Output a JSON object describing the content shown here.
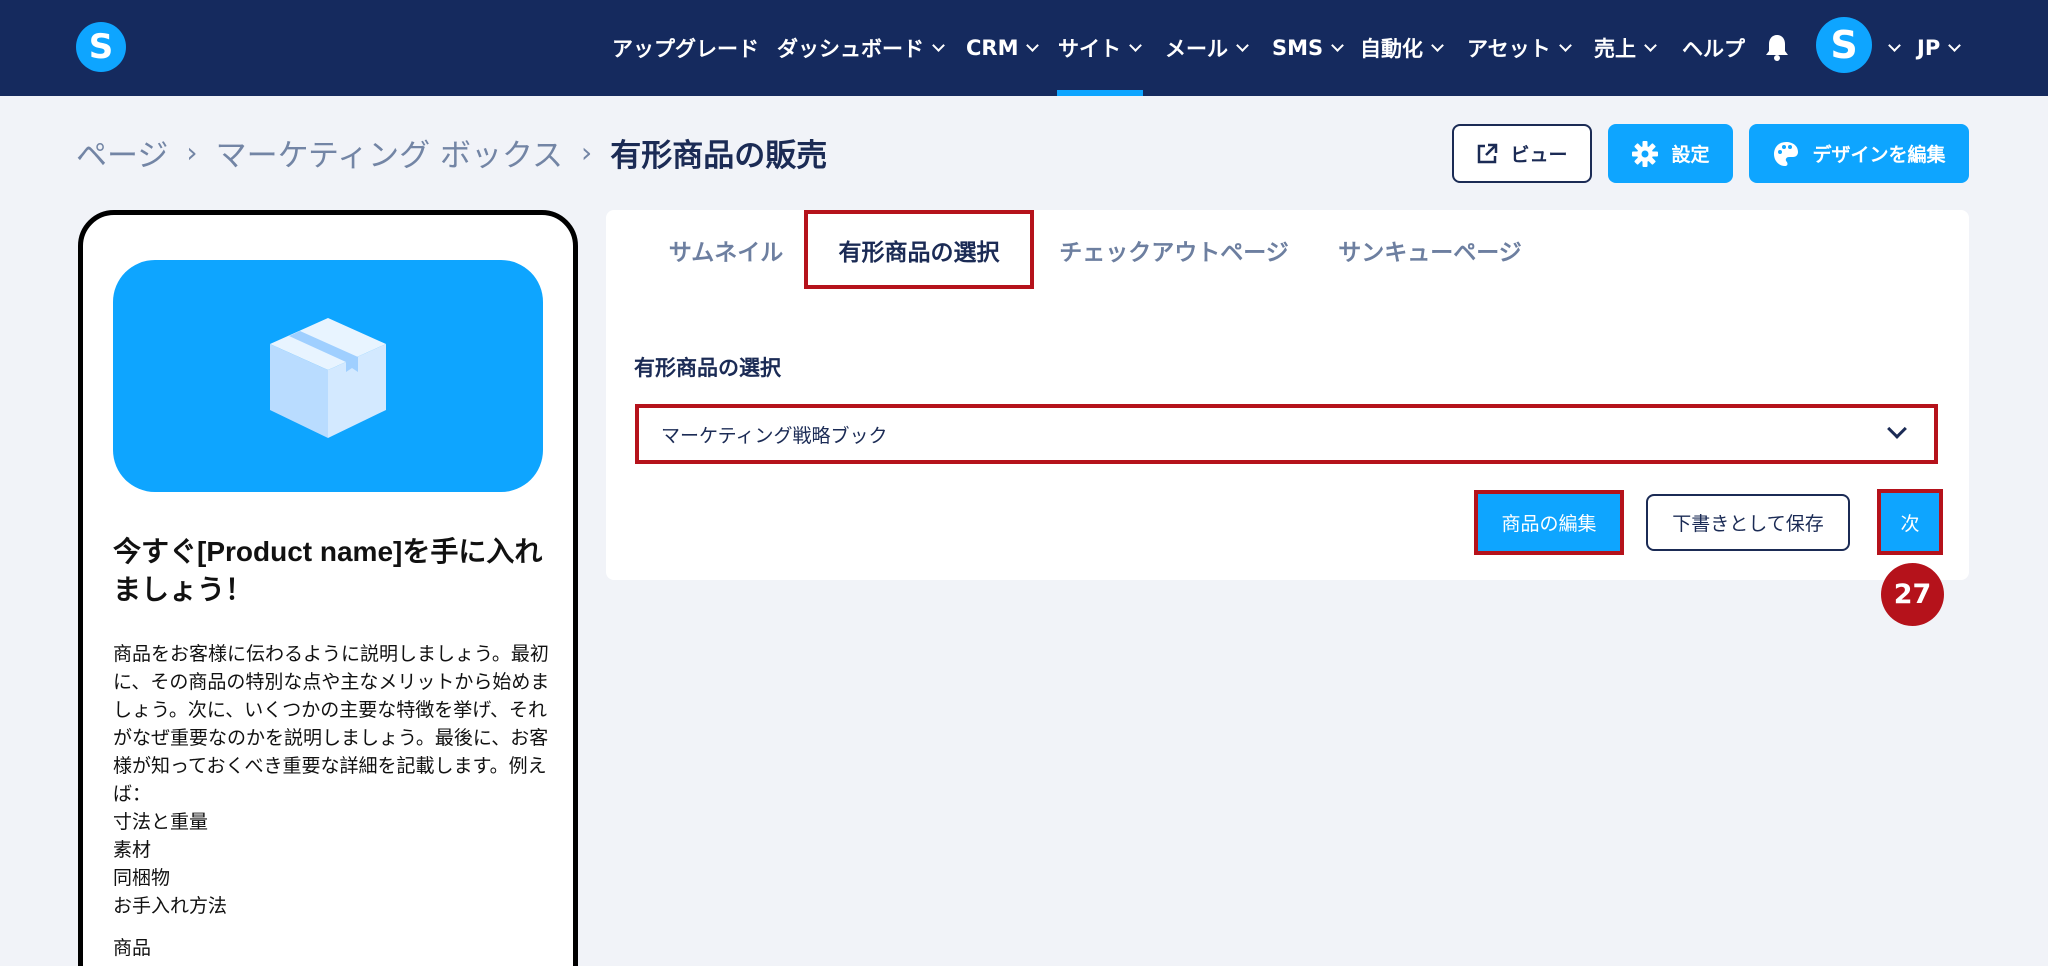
{
  "brand": {
    "logo_letter": "S"
  },
  "nav": {
    "items": [
      {
        "label": "アップグレード",
        "dropdown": false
      },
      {
        "label": "ダッシュボード",
        "dropdown": true
      },
      {
        "label": "CRM",
        "dropdown": true
      },
      {
        "label": "サイト",
        "dropdown": true,
        "active": true
      },
      {
        "label": "メール",
        "dropdown": true
      },
      {
        "label": "SMS",
        "dropdown": true
      },
      {
        "label": "自動化",
        "dropdown": true
      },
      {
        "label": "アセット",
        "dropdown": true
      },
      {
        "label": "売上",
        "dropdown": true
      },
      {
        "label": "ヘルプ",
        "dropdown": false
      }
    ],
    "avatar_letter": "S",
    "language": "JP"
  },
  "breadcrumb": {
    "items": [
      "ページ",
      "マーケティング ボックス"
    ],
    "current": "有形商品の販売"
  },
  "header_buttons": {
    "view": "ビュー",
    "settings": "設定",
    "design": "デザインを編集"
  },
  "preview": {
    "title": "今すぐ[Product name]を手に入れましょう！",
    "paragraph": "商品をお客様に伝わるように説明しましょう。最初に、その商品の特別な点や主なメリットから始めましょう。次に、いくつかの主要な特徴を挙げ、それがなぜ重要なのかを説明しましょう。最後に、お客様が知っておくべき重要な詳細を記載します。例えば：",
    "details": [
      "寸法と重量",
      "素材",
      "同梱物",
      "お手入れ方法"
    ],
    "footer": "商品"
  },
  "tabs": [
    {
      "label": "サムネイル"
    },
    {
      "label": "有形商品の選択",
      "active": true
    },
    {
      "label": "チェックアウトページ"
    },
    {
      "label": "サンキューページ"
    }
  ],
  "form": {
    "section_label": "有形商品の選択",
    "selected_product": "マーケティング戦略ブック"
  },
  "actions": {
    "edit": "商品の編集",
    "draft": "下書きとして保存",
    "next": "次"
  },
  "step_badge": "27",
  "colors": {
    "nav_bg": "#152a5e",
    "accent": "#0ea5ff",
    "highlight": "#b5121b",
    "text": "#1b2b55"
  }
}
